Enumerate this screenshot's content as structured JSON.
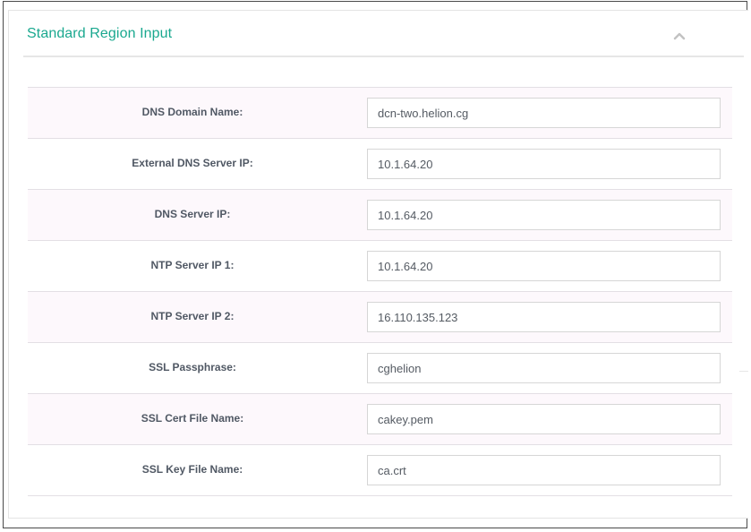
{
  "panel": {
    "title": "Standard Region Input",
    "collapse_icon": "chevron-up-icon",
    "accent_color": "#1aa88f"
  },
  "fields": [
    {
      "label": "DNS Domain Name:",
      "value": "dcn-two.helion.cg"
    },
    {
      "label": "External DNS Server IP:",
      "value": "10.1.64.20"
    },
    {
      "label": "DNS Server IP:",
      "value": "10.1.64.20"
    },
    {
      "label": "NTP Server IP 1:",
      "value": "10.1.64.20"
    },
    {
      "label": "NTP Server IP 2:",
      "value": "16.110.135.123"
    },
    {
      "label": "SSL Passphrase:",
      "value": "cghelion"
    },
    {
      "label": "SSL Cert File Name:",
      "value": "cakey.pem"
    },
    {
      "label": "SSL Key File Name:",
      "value": "ca.crt"
    }
  ]
}
